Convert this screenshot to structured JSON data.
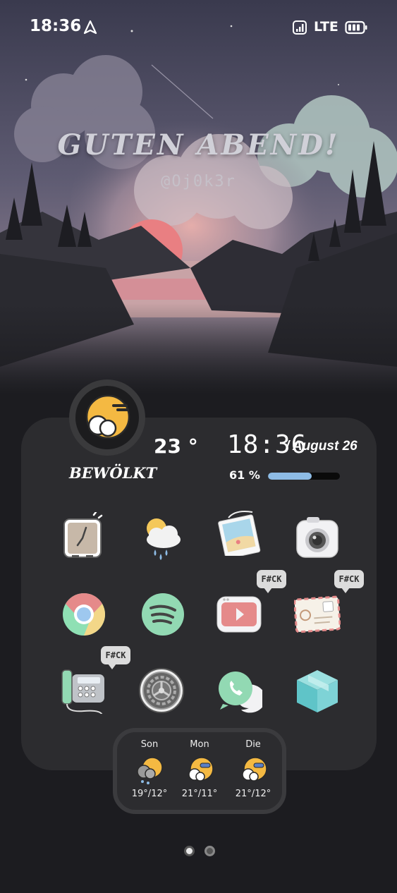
{
  "status_bar": {
    "time": "18:36",
    "network": "LTE",
    "icons": [
      "navigation-icon",
      "signal-icon",
      "battery-icon"
    ]
  },
  "wallpaper": {
    "greeting": "GUTEN ABEND!",
    "handle": "@Oj0k3r"
  },
  "widget": {
    "condition": "BEWÖLKT",
    "temperature": "23 °",
    "clock": "18:36",
    "date": "/ August 26",
    "battery_percent": "61 %",
    "battery_level": 0.61,
    "battery_color": "#8ebce6"
  },
  "apps": [
    {
      "name": "clock-app",
      "icon": "alarm-clock-icon"
    },
    {
      "name": "weather-app",
      "icon": "weather-icon"
    },
    {
      "name": "gallery-app",
      "icon": "photo-icon"
    },
    {
      "name": "camera-app",
      "icon": "camera-icon"
    },
    {
      "name": "chrome-app",
      "icon": "chrome-icon"
    },
    {
      "name": "spotify-app",
      "icon": "spotify-icon"
    },
    {
      "name": "youtube-app",
      "icon": "youtube-icon",
      "badge": "F#CK"
    },
    {
      "name": "mail-app",
      "icon": "envelope-icon",
      "badge": "F#CK"
    },
    {
      "name": "phone-app",
      "icon": "phone-icon",
      "badge": "F#CK"
    },
    {
      "name": "settings-app",
      "icon": "gear-icon"
    },
    {
      "name": "whatsapp-app",
      "icon": "whatsapp-icon"
    },
    {
      "name": "box-app",
      "icon": "box-icon"
    }
  ],
  "forecast": [
    {
      "day": "Son",
      "temps": "19°/12°",
      "icon": "rain-cloud-icon"
    },
    {
      "day": "Mon",
      "temps": "21°/11°",
      "icon": "cloudy-sun-icon"
    },
    {
      "day": "Die",
      "temps": "21°/12°",
      "icon": "cloudy-sun-icon"
    }
  ],
  "page_indicator": {
    "pages": 2,
    "current": 1
  }
}
